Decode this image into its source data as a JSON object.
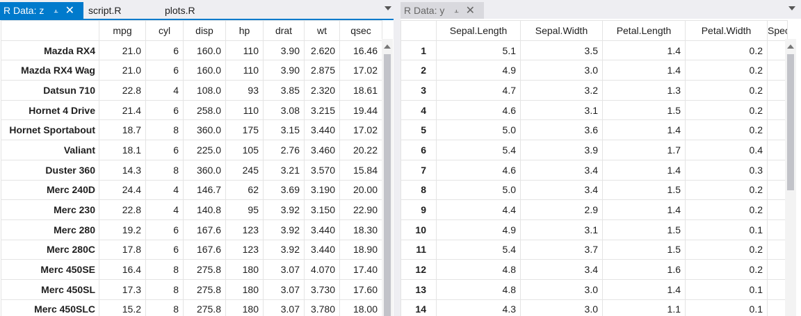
{
  "left": {
    "tabs": [
      {
        "label": "R Data: z",
        "active": true
      },
      {
        "label": "script.R"
      },
      {
        "label": "plots.R"
      }
    ],
    "columns": [
      "mpg",
      "cyl",
      "disp",
      "hp",
      "drat",
      "wt",
      "qsec"
    ],
    "rows": [
      {
        "name": "Mazda RX4",
        "cells": [
          "21.0",
          "6",
          "160.0",
          "110",
          "3.90",
          "2.620",
          "16.46"
        ]
      },
      {
        "name": "Mazda RX4 Wag",
        "cells": [
          "21.0",
          "6",
          "160.0",
          "110",
          "3.90",
          "2.875",
          "17.02"
        ]
      },
      {
        "name": "Datsun 710",
        "cells": [
          "22.8",
          "4",
          "108.0",
          "93",
          "3.85",
          "2.320",
          "18.61"
        ]
      },
      {
        "name": "Hornet 4 Drive",
        "cells": [
          "21.4",
          "6",
          "258.0",
          "110",
          "3.08",
          "3.215",
          "19.44"
        ]
      },
      {
        "name": "Hornet Sportabout",
        "cells": [
          "18.7",
          "8",
          "360.0",
          "175",
          "3.15",
          "3.440",
          "17.02"
        ]
      },
      {
        "name": "Valiant",
        "cells": [
          "18.1",
          "6",
          "225.0",
          "105",
          "2.76",
          "3.460",
          "20.22"
        ]
      },
      {
        "name": "Duster 360",
        "cells": [
          "14.3",
          "8",
          "360.0",
          "245",
          "3.21",
          "3.570",
          "15.84"
        ]
      },
      {
        "name": "Merc 240D",
        "cells": [
          "24.4",
          "4",
          "146.7",
          "62",
          "3.69",
          "3.190",
          "20.00"
        ]
      },
      {
        "name": "Merc 230",
        "cells": [
          "22.8",
          "4",
          "140.8",
          "95",
          "3.92",
          "3.150",
          "22.90"
        ]
      },
      {
        "name": "Merc 280",
        "cells": [
          "19.2",
          "6",
          "167.6",
          "123",
          "3.92",
          "3.440",
          "18.30"
        ]
      },
      {
        "name": "Merc 280C",
        "cells": [
          "17.8",
          "6",
          "167.6",
          "123",
          "3.92",
          "3.440",
          "18.90"
        ]
      },
      {
        "name": "Merc 450SE",
        "cells": [
          "16.4",
          "8",
          "275.8",
          "180",
          "3.07",
          "4.070",
          "17.40"
        ]
      },
      {
        "name": "Merc 450SL",
        "cells": [
          "17.3",
          "8",
          "275.8",
          "180",
          "3.07",
          "3.730",
          "17.60"
        ]
      },
      {
        "name": "Merc 450SLC",
        "cells": [
          "15.2",
          "8",
          "275.8",
          "180",
          "3.07",
          "3.780",
          "18.00"
        ]
      }
    ]
  },
  "right": {
    "tabs": [
      {
        "label": "R Data: y",
        "active": false
      }
    ],
    "columns": [
      "Sepal.Length",
      "Sepal.Width",
      "Petal.Length",
      "Petal.Width",
      "Species"
    ],
    "rows": [
      {
        "name": "1",
        "cells": [
          "5.1",
          "3.5",
          "1.4",
          "0.2"
        ]
      },
      {
        "name": "2",
        "cells": [
          "4.9",
          "3.0",
          "1.4",
          "0.2"
        ]
      },
      {
        "name": "3",
        "cells": [
          "4.7",
          "3.2",
          "1.3",
          "0.2"
        ]
      },
      {
        "name": "4",
        "cells": [
          "4.6",
          "3.1",
          "1.5",
          "0.2"
        ]
      },
      {
        "name": "5",
        "cells": [
          "5.0",
          "3.6",
          "1.4",
          "0.2"
        ]
      },
      {
        "name": "6",
        "cells": [
          "5.4",
          "3.9",
          "1.7",
          "0.4"
        ]
      },
      {
        "name": "7",
        "cells": [
          "4.6",
          "3.4",
          "1.4",
          "0.3"
        ]
      },
      {
        "name": "8",
        "cells": [
          "5.0",
          "3.4",
          "1.5",
          "0.2"
        ]
      },
      {
        "name": "9",
        "cells": [
          "4.4",
          "2.9",
          "1.4",
          "0.2"
        ]
      },
      {
        "name": "10",
        "cells": [
          "4.9",
          "3.1",
          "1.5",
          "0.1"
        ]
      },
      {
        "name": "11",
        "cells": [
          "5.4",
          "3.7",
          "1.5",
          "0.2"
        ]
      },
      {
        "name": "12",
        "cells": [
          "4.8",
          "3.4",
          "1.6",
          "0.2"
        ]
      },
      {
        "name": "13",
        "cells": [
          "4.8",
          "3.0",
          "1.4",
          "0.1"
        ]
      },
      {
        "name": "14",
        "cells": [
          "4.3",
          "3.0",
          "1.1",
          "0.1"
        ]
      }
    ]
  },
  "colors": {
    "accent": "#007acc",
    "tabbar": "#eeeef2",
    "gridline": "#e4e4e4",
    "scroll_thumb": "#c2c3c9"
  }
}
